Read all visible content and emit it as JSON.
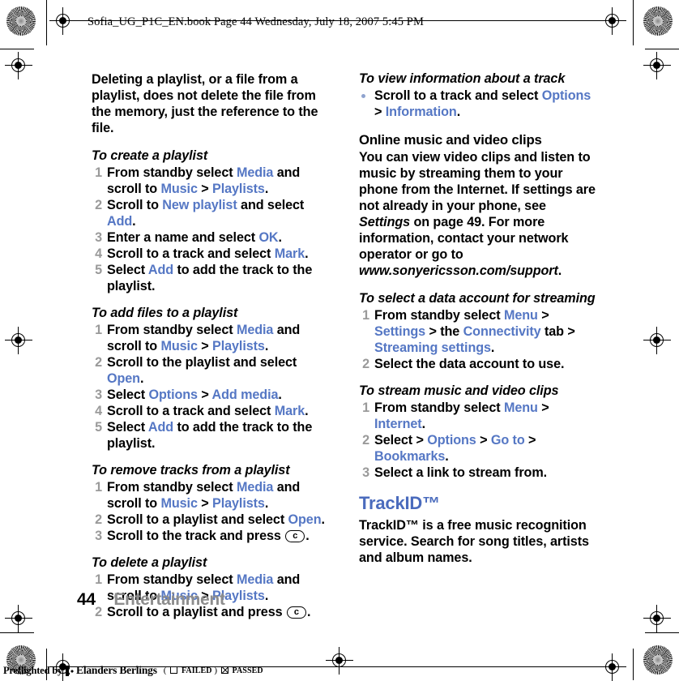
{
  "header": {
    "text": "Sofia_UG_P1C_EN.book  Page 44  Wednesday, July 18, 2007  5:45 PM"
  },
  "footer": {
    "page_number": "44",
    "section_title": "Entertainment"
  },
  "preflight": {
    "label": "Preflighted by",
    "company": "Elanders Berlings",
    "open_paren": "(",
    "failed_label": "FAILED",
    "close_paren": ")",
    "passed_label": "PASSED"
  },
  "key_c": "c",
  "left_column": {
    "intro_paragraph": "Deleting a playlist, or a file from a playlist, does not delete the file from the memory, just the reference to the file.",
    "sections": [
      {
        "heading": "To create a playlist",
        "steps": [
          [
            {
              "t": "text",
              "v": "From standby select "
            },
            {
              "t": "ui",
              "v": "Media"
            },
            {
              "t": "text",
              "v": " and scroll to "
            },
            {
              "t": "ui",
              "v": "Music"
            },
            {
              "t": "text",
              "v": " > "
            },
            {
              "t": "ui",
              "v": "Playlists"
            },
            {
              "t": "text",
              "v": "."
            }
          ],
          [
            {
              "t": "text",
              "v": "Scroll to "
            },
            {
              "t": "ui",
              "v": "New playlist"
            },
            {
              "t": "text",
              "v": " and select "
            },
            {
              "t": "ui",
              "v": "Add"
            },
            {
              "t": "text",
              "v": "."
            }
          ],
          [
            {
              "t": "text",
              "v": "Enter a name and select "
            },
            {
              "t": "ui",
              "v": "OK"
            },
            {
              "t": "text",
              "v": "."
            }
          ],
          [
            {
              "t": "text",
              "v": "Scroll to a track and select "
            },
            {
              "t": "ui",
              "v": "Mark"
            },
            {
              "t": "text",
              "v": "."
            }
          ],
          [
            {
              "t": "text",
              "v": "Select "
            },
            {
              "t": "ui",
              "v": "Add"
            },
            {
              "t": "text",
              "v": " to add the track to the playlist."
            }
          ]
        ]
      },
      {
        "heading": "To add files to a playlist",
        "steps": [
          [
            {
              "t": "text",
              "v": "From standby select "
            },
            {
              "t": "ui",
              "v": "Media"
            },
            {
              "t": "text",
              "v": " and scroll to "
            },
            {
              "t": "ui",
              "v": "Music"
            },
            {
              "t": "text",
              "v": " > "
            },
            {
              "t": "ui",
              "v": "Playlists"
            },
            {
              "t": "text",
              "v": "."
            }
          ],
          [
            {
              "t": "text",
              "v": "Scroll to the playlist and select "
            },
            {
              "t": "ui",
              "v": "Open"
            },
            {
              "t": "text",
              "v": "."
            }
          ],
          [
            {
              "t": "text",
              "v": "Select "
            },
            {
              "t": "ui",
              "v": "Options"
            },
            {
              "t": "text",
              "v": " > "
            },
            {
              "t": "ui",
              "v": "Add media"
            },
            {
              "t": "text",
              "v": "."
            }
          ],
          [
            {
              "t": "text",
              "v": "Scroll to a track and select "
            },
            {
              "t": "ui",
              "v": "Mark"
            },
            {
              "t": "text",
              "v": "."
            }
          ],
          [
            {
              "t": "text",
              "v": "Select "
            },
            {
              "t": "ui",
              "v": "Add"
            },
            {
              "t": "text",
              "v": " to add the track to the playlist."
            }
          ]
        ]
      },
      {
        "heading": "To remove tracks from a playlist",
        "steps": [
          [
            {
              "t": "text",
              "v": "From standby select "
            },
            {
              "t": "ui",
              "v": "Media"
            },
            {
              "t": "text",
              "v": " and scroll to "
            },
            {
              "t": "ui",
              "v": "Music"
            },
            {
              "t": "text",
              "v": " > "
            },
            {
              "t": "ui",
              "v": "Playlists"
            },
            {
              "t": "text",
              "v": "."
            }
          ],
          [
            {
              "t": "text",
              "v": "Scroll to a playlist and select "
            },
            {
              "t": "ui",
              "v": "Open"
            },
            {
              "t": "text",
              "v": "."
            }
          ],
          [
            {
              "t": "text",
              "v": "Scroll to the track and press "
            },
            {
              "t": "key",
              "v": "c"
            },
            {
              "t": "text",
              "v": "."
            }
          ]
        ]
      },
      {
        "heading": "To delete a playlist",
        "steps": [
          [
            {
              "t": "text",
              "v": "From standby select "
            },
            {
              "t": "ui",
              "v": "Media"
            },
            {
              "t": "text",
              "v": " and scroll to "
            },
            {
              "t": "ui",
              "v": "Music"
            },
            {
              "t": "text",
              "v": " > "
            },
            {
              "t": "ui",
              "v": "Playlists"
            },
            {
              "t": "text",
              "v": "."
            }
          ],
          [
            {
              "t": "text",
              "v": "Scroll to a playlist and press "
            },
            {
              "t": "key",
              "v": "c"
            },
            {
              "t": "text",
              "v": "."
            }
          ]
        ]
      }
    ]
  },
  "right_column": {
    "view_info": {
      "heading": "To view information about a track",
      "bullets": [
        [
          {
            "t": "text",
            "v": "Scroll to a track and select "
          },
          {
            "t": "ui",
            "v": "Options"
          },
          {
            "t": "text",
            "v": " > "
          },
          {
            "t": "ui",
            "v": "Information"
          },
          {
            "t": "text",
            "v": "."
          }
        ]
      ]
    },
    "online_clips": {
      "heading": "Online music and video clips",
      "paragraph": [
        {
          "t": "text",
          "v": "You can view video clips and listen to music by streaming them to your phone from the Internet. If settings are not already in your phone, see "
        },
        {
          "t": "italic",
          "v": "Settings"
        },
        {
          "t": "text",
          "v": " on page 49. For more information, contact your network operator or go to "
        },
        {
          "t": "italic",
          "v": "www.sonyericsson.com/support"
        },
        {
          "t": "text",
          "v": "."
        }
      ]
    },
    "data_account": {
      "heading": "To select a data account for streaming",
      "steps": [
        [
          {
            "t": "text",
            "v": "From standby select "
          },
          {
            "t": "ui",
            "v": "Menu"
          },
          {
            "t": "text",
            "v": " > "
          },
          {
            "t": "ui",
            "v": "Settings"
          },
          {
            "t": "text",
            "v": " > the "
          },
          {
            "t": "ui",
            "v": "Connectivity"
          },
          {
            "t": "text",
            "v": " tab > "
          },
          {
            "t": "ui",
            "v": "Streaming settings"
          },
          {
            "t": "text",
            "v": "."
          }
        ],
        [
          {
            "t": "text",
            "v": "Select the data account to use."
          }
        ]
      ]
    },
    "stream_clips": {
      "heading": "To stream music and video clips",
      "steps": [
        [
          {
            "t": "text",
            "v": "From standby select "
          },
          {
            "t": "ui",
            "v": "Menu"
          },
          {
            "t": "text",
            "v": " > "
          },
          {
            "t": "ui",
            "v": "Internet"
          },
          {
            "t": "text",
            "v": "."
          }
        ],
        [
          {
            "t": "text",
            "v": "Select > "
          },
          {
            "t": "ui",
            "v": "Options"
          },
          {
            "t": "text",
            "v": " > "
          },
          {
            "t": "ui",
            "v": "Go to"
          },
          {
            "t": "text",
            "v": " > "
          },
          {
            "t": "ui",
            "v": "Bookmarks"
          },
          {
            "t": "text",
            "v": "."
          }
        ],
        [
          {
            "t": "text",
            "v": "Select a link to stream from."
          }
        ]
      ]
    },
    "trackid": {
      "heading": "TrackID™",
      "paragraph": "TrackID™ is a free music recognition service. Search for song titles, artists and album names."
    }
  },
  "colors": {
    "ui_term": "#5577c4",
    "chapter_heading": "#4a6bbd",
    "step_number": "#9a9a9a",
    "footer_title": "#8d8d8d"
  }
}
